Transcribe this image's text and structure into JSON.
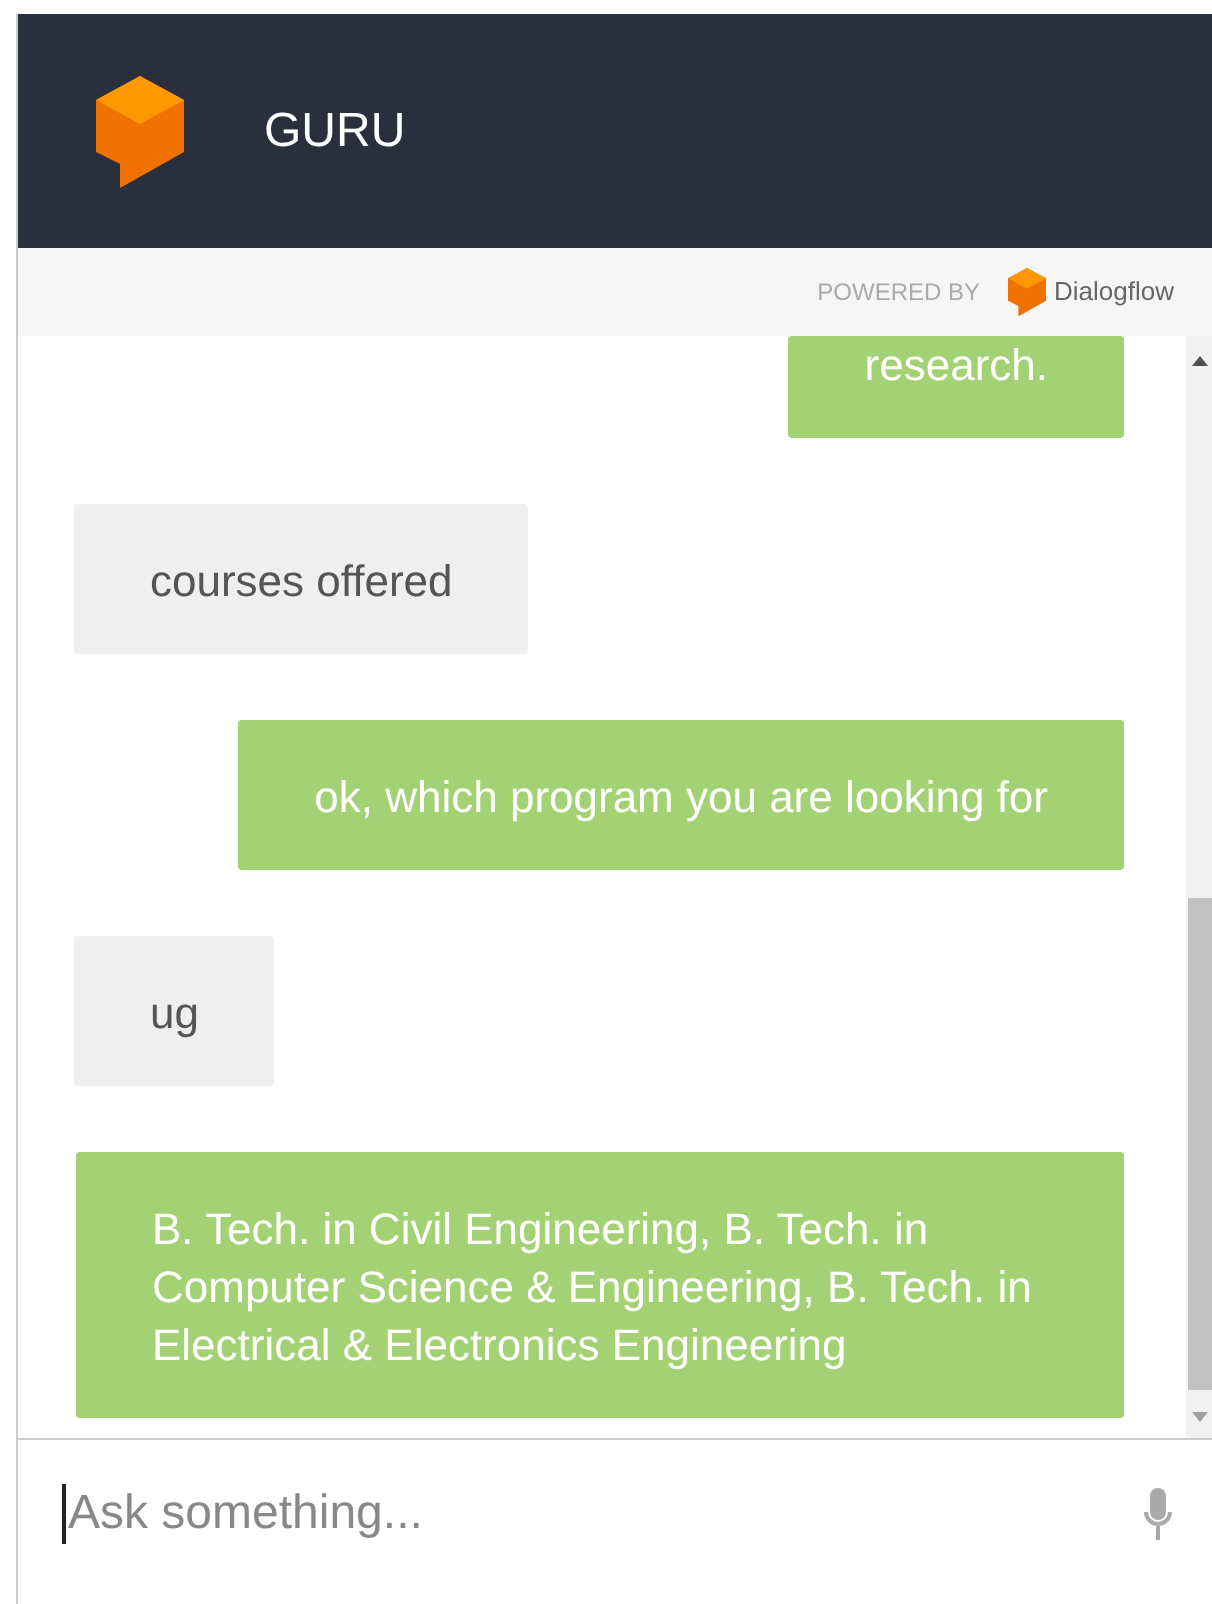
{
  "header": {
    "title": "GURU"
  },
  "powered_by": {
    "label": "POWERED BY",
    "brand": "Dialogflow"
  },
  "messages": [
    {
      "kind": "bot",
      "text": "research."
    },
    {
      "kind": "user",
      "text": "courses offered"
    },
    {
      "kind": "bot",
      "text": "ok, which program you are looking for"
    },
    {
      "kind": "user",
      "text": "ug"
    },
    {
      "kind": "bot",
      "text": "B. Tech. in Civil Engineering, B. Tech. in Computer Science & Engineering, B. Tech. in Electrical & Electronics Engineering"
    }
  ],
  "input": {
    "placeholder": "Ask something..."
  }
}
